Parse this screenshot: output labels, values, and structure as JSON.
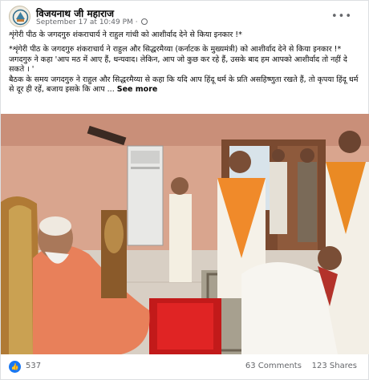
{
  "post": {
    "author": "विजयनाथ जी महाराज",
    "timestamp": "September 17 at 10:49 PM",
    "privacy_icon": "globe-icon",
    "more_icon": "more-options-icon",
    "text": {
      "line1": "शृंगेरी पीठ के जगदगुरु शंकराचार्य ने राहुल गांधी को आशीर्वाद देने से किया इनकार !*",
      "para2": "*शृंगेरी पीठ के जगदगुरु शंकराचार्य ने राहुल और सिद्धरमैय्या (कर्नाटक के मुख्यमंत्री) को आशीर्वाद देने से किया इनकार !*",
      "para3": "जगदगुरु ने कहा 'आप मठ में आए हैं, धन्यवाद। लेकिन, आप जो कुछ कर रहे हैं, उसके बाद हम आपको आशीर्वाद तो नहीं दे सकते । '",
      "para4": "बैठक के समय जगदगुरु ने राहुल और सिद्धरमैय्या से कहा कि यदि आप हिंदू धर्म के प्रति असहिष्णुता रखते हैं, तो कृपया हिंदू धर्म से दूर ही रहें, बजाय इसके कि आप ...",
      "see_more": "See more"
    }
  },
  "footer": {
    "like_icon": "thumbs-up-icon",
    "likes": "537",
    "comments": "63 Comments",
    "shares": "123 Shares"
  }
}
